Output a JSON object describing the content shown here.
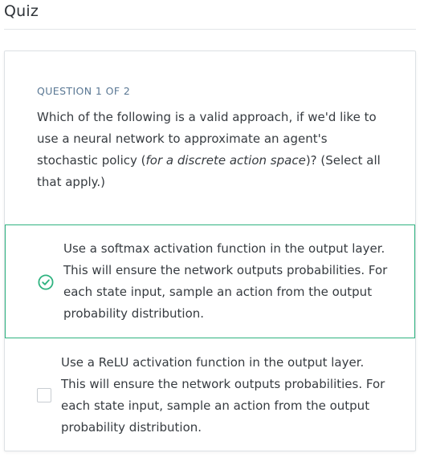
{
  "page": {
    "title": "Quiz"
  },
  "question": {
    "counter": "QUESTION 1 OF 2",
    "text_part1": "Which of the following is a valid approach, if we'd like to use a neural network to approximate an agent's stochastic policy (",
    "text_italic": "for a discrete action space",
    "text_part2": ")? (Select all that apply.)"
  },
  "options": [
    {
      "text": "Use a softmax activation function in the output layer. This will ensure the network outputs probabilities. For each state input, sample an action from the output probability distribution.",
      "selected": true,
      "icon": "check-circle-icon"
    },
    {
      "text": "Use a ReLU activation function in the output layer. This will ensure the network outputs probabilities. For each state input, sample an action from the output probability distribution.",
      "selected": false,
      "icon": "checkbox-empty-icon"
    }
  ],
  "colors": {
    "accent": "#2fb380",
    "counter": "#5a7894",
    "border": "#dde1e5"
  }
}
